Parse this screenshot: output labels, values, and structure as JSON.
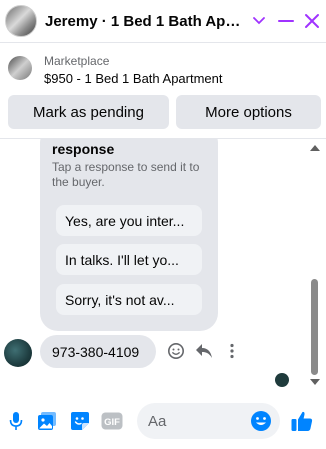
{
  "header": {
    "title": "Jeremy · 1 Bed 1 Bath Apartment",
    "chevron_icon": "chevron-down-icon",
    "minimize_icon": "minimize-icon",
    "close_icon": "close-icon"
  },
  "marketplace": {
    "label": "Marketplace",
    "item": "$950 - 1 Bed 1 Bath Apartment",
    "mark_pending_label": "Mark as pending",
    "more_options_label": "More options"
  },
  "responses": {
    "title": "response",
    "subtitle": "Tap a response to send it to the buyer.",
    "items": [
      "Yes, are you inter...",
      "In talks. I'll let yo...",
      "Sorry, it's not av..."
    ]
  },
  "messages": [
    {
      "text": "973-380-4109"
    }
  ],
  "composer": {
    "placeholder": "Aa",
    "gif_label": "GIF"
  },
  "colors": {
    "accent": "#0084ff",
    "purple": "#a033ff",
    "bubble": "#e4e6eb",
    "muted_text": "#65676b"
  }
}
